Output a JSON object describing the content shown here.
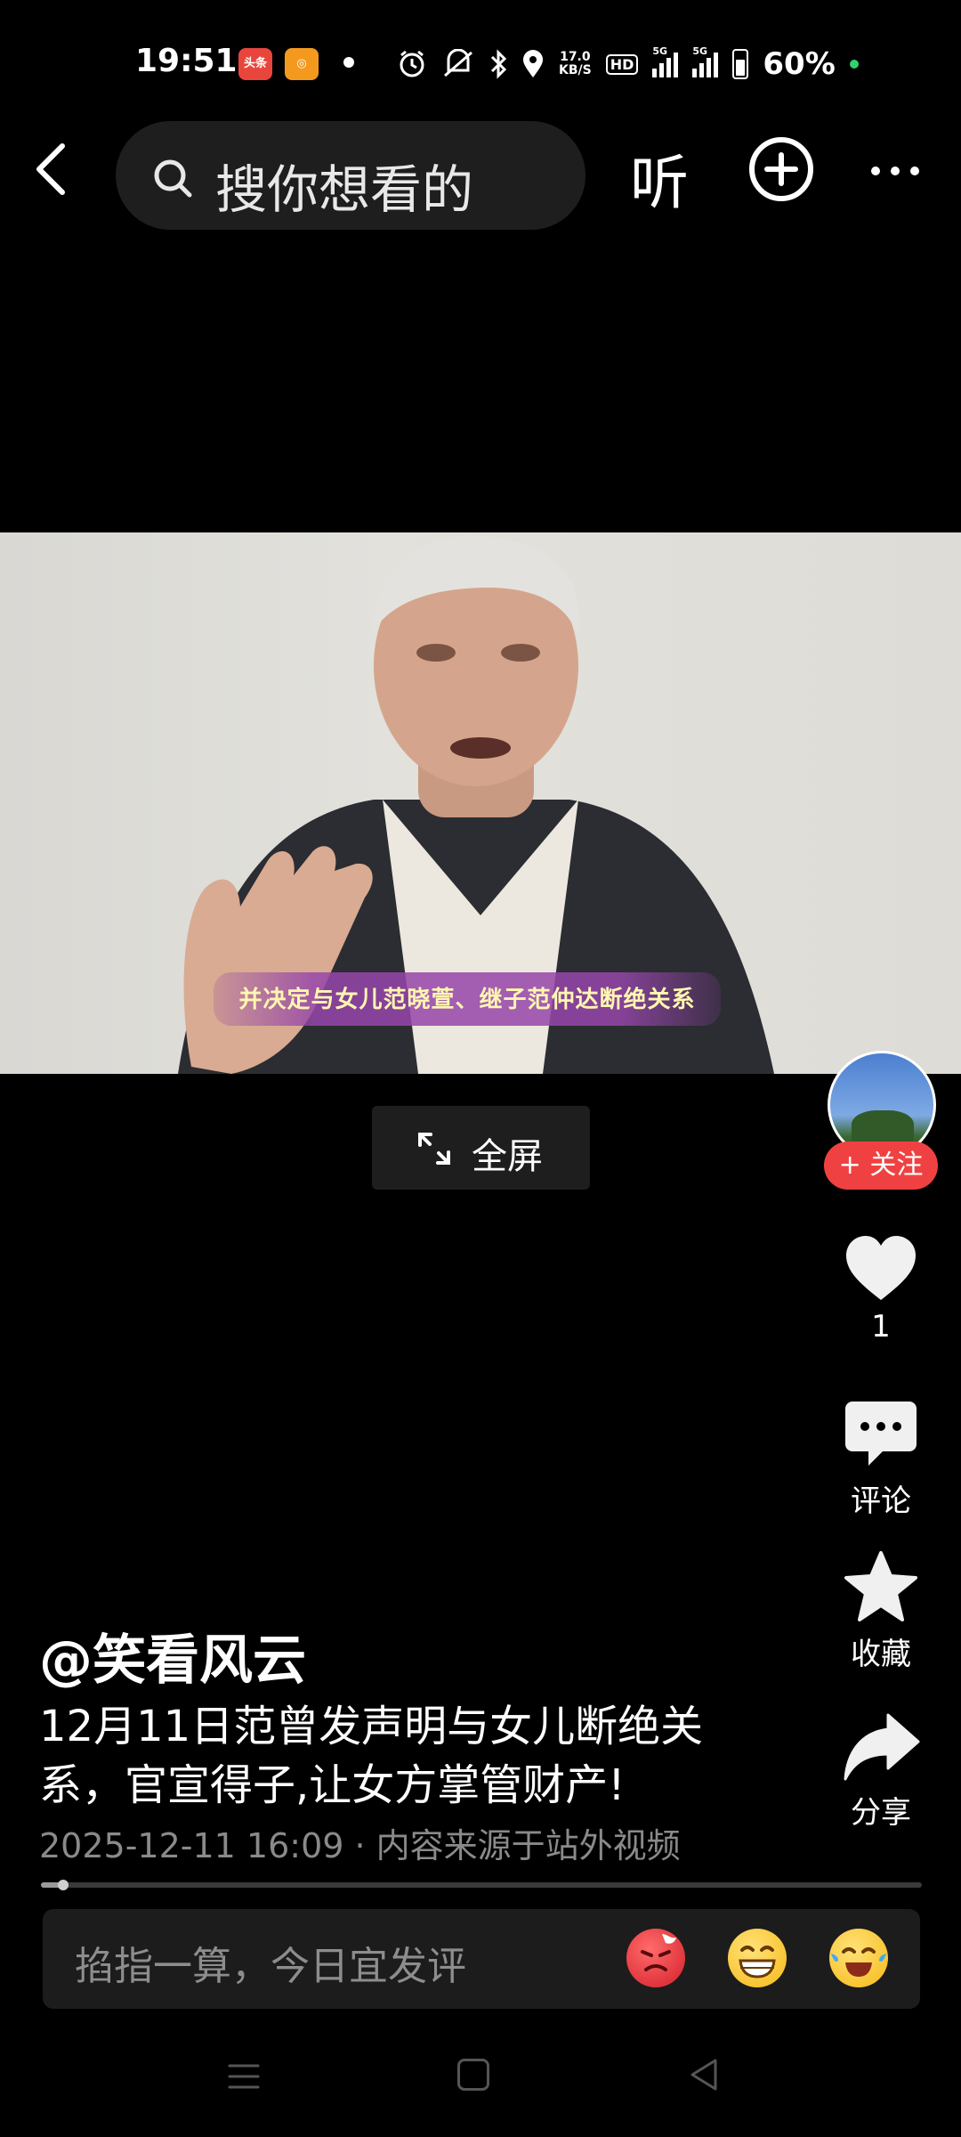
{
  "status_bar": {
    "time": "19:51",
    "app_badges": [
      "头条",
      "今日头条极速版"
    ],
    "net_speed_top": "17.0",
    "net_speed_bottom": "KB/S",
    "hd_label": "HD",
    "signal1": "5G",
    "signal2": "5G",
    "battery_percent": "60%",
    "icons": [
      "alarm-icon",
      "mute-icon",
      "bluetooth-icon",
      "location-icon"
    ]
  },
  "top_nav": {
    "search_placeholder": "搜你想看的",
    "listen_label": "听"
  },
  "video": {
    "subtitle": "并决定与女儿范晓萱、继子范仲达断绝关系",
    "fullscreen_label": "全屏"
  },
  "actions": {
    "follow_label": "+ 关注",
    "like_count": "1",
    "comment_label": "评论",
    "favorite_label": "收藏",
    "share_label": "分享"
  },
  "post": {
    "author": "@笑看风云",
    "description": "12月11日范曾发声明与女儿断绝关系，官宣得子,让女方掌管财产!",
    "meta": "2025-12-11 16:09 · 内容来源于站外视频",
    "progress": 0.025
  },
  "comment_bar": {
    "placeholder": "掐指一算，今日宜发评",
    "emojis": [
      "angry-emoji",
      "grin-emoji",
      "laugh-cry-emoji"
    ]
  },
  "colors": {
    "background": "#000000",
    "follow_red": "#f04142",
    "search_bg": "#1e1e1e",
    "meta_gray": "#8a8a8a"
  }
}
